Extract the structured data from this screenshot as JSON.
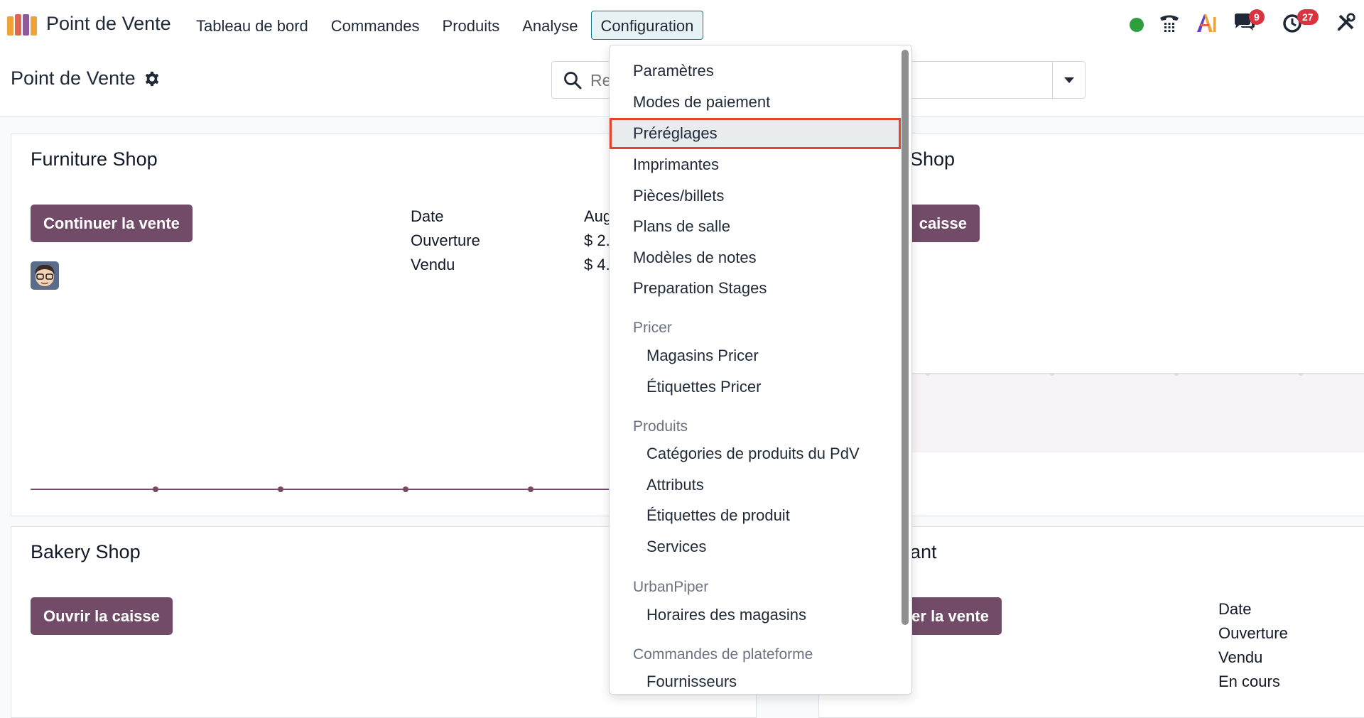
{
  "navbar": {
    "app_name": "Point de Vente",
    "menu": [
      {
        "label": "Tableau de bord"
      },
      {
        "label": "Commandes"
      },
      {
        "label": "Produits"
      },
      {
        "label": "Analyse"
      },
      {
        "label": "Configuration",
        "active": true
      }
    ],
    "badges": {
      "messages": "9",
      "activities": "27"
    },
    "colors": {
      "presence": "#2e9e3e",
      "badge": "#d9333f",
      "accent": "#0e7a83"
    }
  },
  "control_panel": {
    "title": "Point de Vente",
    "search_placeholder": "Rechercher..."
  },
  "cards": [
    {
      "title": "Furniture Shop",
      "button": "Continuer la vente",
      "stats_labels": [
        "Date",
        "Ouverture",
        "Vendu"
      ],
      "stats_values": [
        "Aug",
        "$ 2.",
        "$ 4."
      ]
    },
    {
      "title": "Shop",
      "button": "caisse"
    },
    {
      "title": "Bakery Shop",
      "button": "Ouvrir la caisse"
    },
    {
      "title": "ant",
      "button": "er la vente",
      "stats_labels": [
        "Date",
        "Ouverture",
        "Vendu",
        "En cours"
      ]
    }
  ],
  "dropdown": {
    "items": [
      {
        "label": "Paramètres"
      },
      {
        "label": "Modes de paiement"
      },
      {
        "label": "Préréglages",
        "selected": true
      },
      {
        "label": "Imprimantes"
      },
      {
        "label": "Pièces/billets"
      },
      {
        "label": "Plans de salle"
      },
      {
        "label": "Modèles de notes"
      },
      {
        "label": "Preparation Stages"
      }
    ],
    "sections": [
      {
        "header": "Pricer",
        "items": [
          {
            "label": "Magasins Pricer"
          },
          {
            "label": "Étiquettes Pricer"
          }
        ]
      },
      {
        "header": "Produits",
        "items": [
          {
            "label": "Catégories de produits du PdV"
          },
          {
            "label": "Attributs"
          },
          {
            "label": "Étiquettes de produit"
          },
          {
            "label": "Services"
          }
        ]
      },
      {
        "header": "UrbanPiper",
        "items": [
          {
            "label": "Horaires des magasins"
          }
        ]
      },
      {
        "header": "Commandes de plateforme",
        "items": [
          {
            "label": "Fournisseurs"
          }
        ]
      }
    ]
  },
  "icons": [
    "pos-logo-icon",
    "gear-icon",
    "search-icon",
    "caret-down-icon",
    "phone-icon",
    "ai-icon",
    "chat-icon",
    "clock-icon",
    "tools-icon"
  ]
}
